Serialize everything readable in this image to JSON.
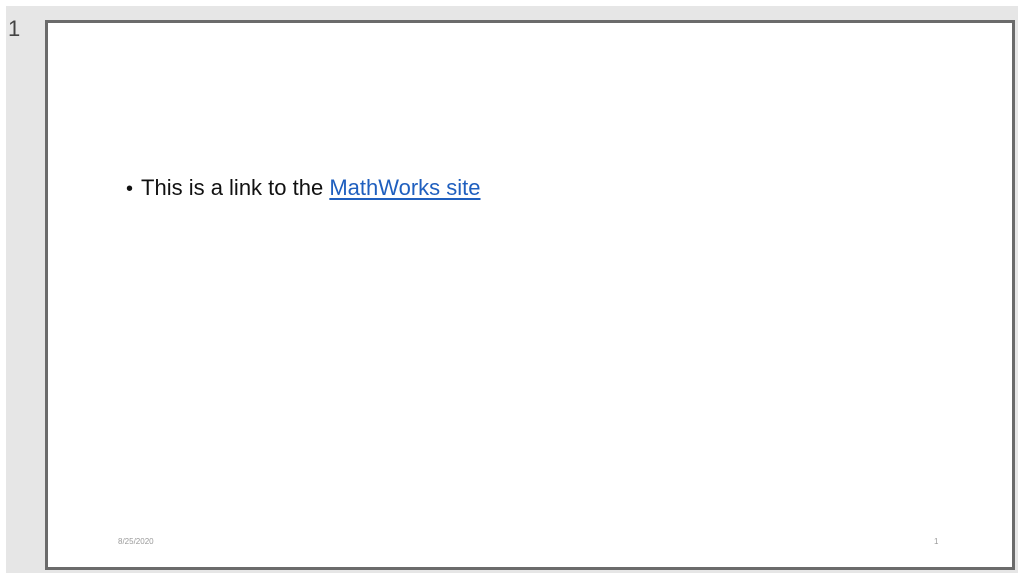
{
  "thumbnail": {
    "slide_number": "1"
  },
  "slide": {
    "bullet_symbol": "•",
    "bullet_text": "This is a link to the ",
    "link_text": "MathWorks site",
    "footer_date": "8/25/2020",
    "footer_page": "1"
  },
  "colors": {
    "link": "#1f5fbf",
    "slide_border": "#6b6b6b",
    "pane_background": "#e6e6e6"
  }
}
